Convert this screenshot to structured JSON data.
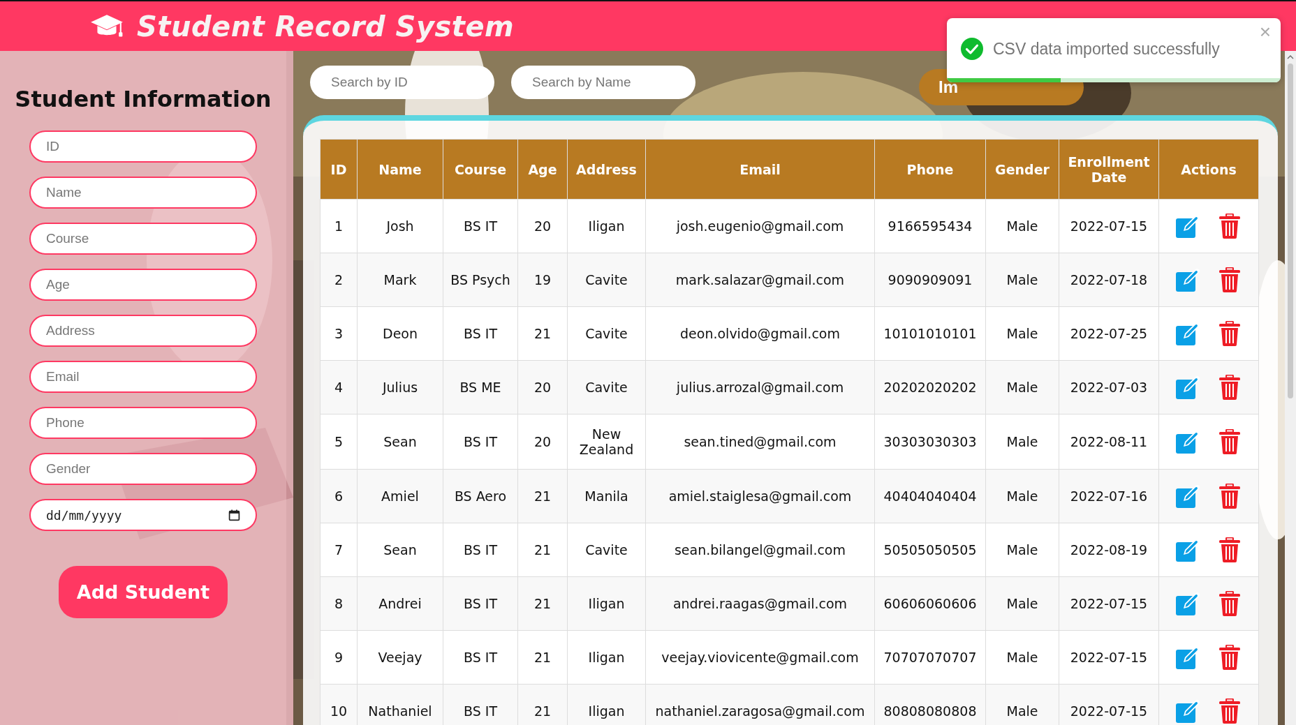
{
  "header": {
    "title": "Student Record System"
  },
  "sidebar": {
    "title": "Student Information",
    "fields": [
      {
        "kind": "text",
        "placeholder": "ID"
      },
      {
        "kind": "text",
        "placeholder": "Name"
      },
      {
        "kind": "text",
        "placeholder": "Course"
      },
      {
        "kind": "text",
        "placeholder": "Age"
      },
      {
        "kind": "text",
        "placeholder": "Address"
      },
      {
        "kind": "text",
        "placeholder": "Email"
      },
      {
        "kind": "text",
        "placeholder": "Phone"
      },
      {
        "kind": "text",
        "placeholder": "Gender"
      },
      {
        "kind": "date",
        "value": "dd/mm/yyyy"
      }
    ],
    "button": "Add Student"
  },
  "toolbar": {
    "search_id": {
      "placeholder": "Search by ID"
    },
    "search_name": {
      "placeholder": "Search by Name"
    },
    "import_button": "Im"
  },
  "table": {
    "columns": [
      "ID",
      "Name",
      "Course",
      "Age",
      "Address",
      "Email",
      "Phone",
      "Gender",
      "Enrollment Date",
      "Actions"
    ],
    "rows": [
      {
        "cells": [
          "1",
          "Josh",
          "BS IT",
          "20",
          "Iligan",
          "josh.eugenio@gmail.com",
          "9166595434",
          "Male",
          "2022-07-15"
        ]
      },
      {
        "cells": [
          "2",
          "Mark",
          "BS Psych",
          "19",
          "Cavite",
          "mark.salazar@gmail.com",
          "9090909091",
          "Male",
          "2022-07-18"
        ]
      },
      {
        "cells": [
          "3",
          "Deon",
          "BS IT",
          "21",
          "Cavite",
          "deon.olvido@gmail.com",
          "10101010101",
          "Male",
          "2022-07-25"
        ]
      },
      {
        "cells": [
          "4",
          "Julius",
          "BS ME",
          "20",
          "Cavite",
          "julius.arrozal@gmail.com",
          "20202020202",
          "Male",
          "2022-07-03"
        ]
      },
      {
        "cells": [
          "5",
          "Sean",
          "BS IT",
          "20",
          "New Zealand",
          "sean.tined@gmail.com",
          "30303030303",
          "Male",
          "2022-08-11"
        ]
      },
      {
        "cells": [
          "6",
          "Amiel",
          "BS Aero",
          "21",
          "Manila",
          "amiel.staiglesa@gmail.com",
          "40404040404",
          "Male",
          "2022-07-16"
        ]
      },
      {
        "cells": [
          "7",
          "Sean",
          "BS IT",
          "21",
          "Cavite",
          "sean.bilangel@gmail.com",
          "50505050505",
          "Male",
          "2022-08-19"
        ]
      },
      {
        "cells": [
          "8",
          "Andrei",
          "BS IT",
          "21",
          "Iligan",
          "andrei.raagas@gmail.com",
          "60606060606",
          "Male",
          "2022-07-15"
        ]
      },
      {
        "cells": [
          "9",
          "Veejay",
          "BS IT",
          "21",
          "Iligan",
          "veejay.viovicente@gmail.com",
          "70707070707",
          "Male",
          "2022-07-15"
        ]
      },
      {
        "cells": [
          "10",
          "Nathaniel",
          "BS IT",
          "21",
          "Iligan",
          "nathaniel.zaragosa@gmail.com",
          "80808080808",
          "Male",
          "2022-07-15"
        ]
      }
    ]
  },
  "toast": {
    "message": "CSV data imported successfully",
    "close": "×",
    "level": 0.34
  }
}
